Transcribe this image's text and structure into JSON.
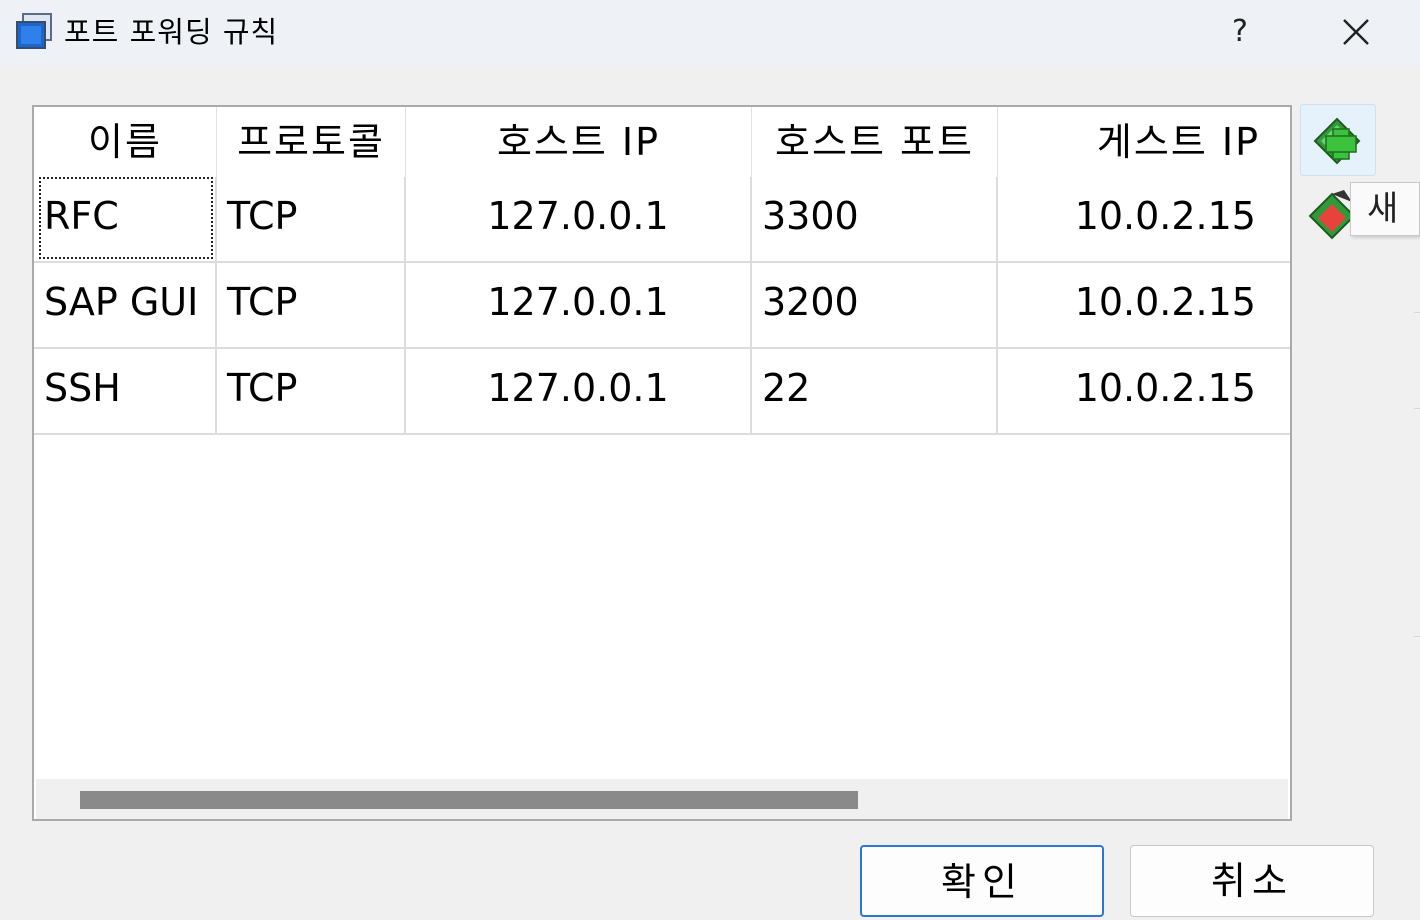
{
  "window": {
    "title": "포트 포워딩 규칙",
    "help_label": "?",
    "icons": {
      "app": "virtualbox-window-icon",
      "close": "close-icon"
    }
  },
  "table": {
    "columns": [
      "이름",
      "프로토콜",
      "호스트 IP",
      "호스트 포트",
      "게스트 IP"
    ],
    "rows": [
      {
        "name": "RFC",
        "protocol": "TCP",
        "host_ip": "127.0.0.1",
        "host_port": "3300",
        "guest_ip": "10.0.2.15"
      },
      {
        "name": "SAP GUI",
        "protocol": "TCP",
        "host_ip": "127.0.0.1",
        "host_port": "3200",
        "guest_ip": "10.0.2.15"
      },
      {
        "name": "SSH",
        "protocol": "TCP",
        "host_ip": "127.0.0.1",
        "host_port": "22",
        "guest_ip": "10.0.2.15"
      }
    ],
    "focused_cell": "RFC"
  },
  "side_tools": {
    "add_icon": "add-rule-icon",
    "edit_icon": "edit-rule-icon",
    "tooltip": "새"
  },
  "buttons": {
    "ok": "확인",
    "cancel": "취소"
  },
  "colors": {
    "accent": "#2a78d4",
    "add_green": "#3cc23c",
    "tool_hover": "#e5f1fb"
  }
}
